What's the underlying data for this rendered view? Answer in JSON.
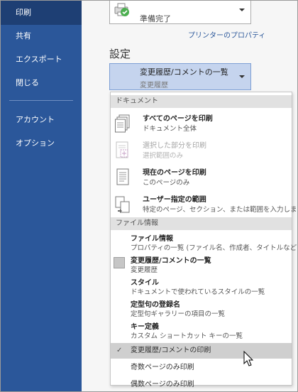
{
  "sidebar": {
    "items": [
      {
        "label": "印刷",
        "active": true
      },
      {
        "label": "共有"
      },
      {
        "label": "エクスポート"
      },
      {
        "label": "閉じる"
      },
      {
        "label": "アカウント"
      },
      {
        "label": "オプション"
      }
    ]
  },
  "printer": {
    "status": "準備完了",
    "properties_link": "プリンターのプロパティ"
  },
  "settings": {
    "heading": "設定",
    "selected_main": "変更履歴/コメントの一覧",
    "selected_sub": "変更履歴"
  },
  "dropdown": {
    "document_header": "ドキュメント",
    "document_options": [
      {
        "title": "すべてのページを印刷",
        "sub": "ドキュメント全体",
        "enabled": true
      },
      {
        "title": "選択した部分を印刷",
        "sub": "選択範囲のみ",
        "enabled": false
      },
      {
        "title": "現在のページを印刷",
        "sub": "このページのみ",
        "enabled": true
      },
      {
        "title": "ユーザー指定の範囲",
        "sub": "特定のページ、セクション、または範囲を入力します",
        "enabled": true
      }
    ],
    "info_header": "ファイル情報",
    "info_options": [
      {
        "title": "ファイル情報",
        "sub": "プロパティの一覧 (ファイル名、作成者、タイトルなど)"
      },
      {
        "title": "変更履歴/コメントの一覧",
        "sub": "変更履歴",
        "selected": true
      },
      {
        "title": "スタイル",
        "sub": "ドキュメントで使われているスタイルの一覧"
      },
      {
        "title": "定型句の登録名",
        "sub": "定型句ギャラリーの項目の一覧"
      },
      {
        "title": "キー定義",
        "sub": "カスタム ショートカット キーの一覧"
      }
    ],
    "extra_options": [
      {
        "label": "変更履歴/コメントの印刷",
        "checked": true,
        "hover": true
      },
      {
        "label": "奇数ページのみ印刷"
      },
      {
        "label": "偶数ページのみ印刷"
      }
    ],
    "checkmark": "✓"
  },
  "colors": {
    "sidebar": "#2b579a",
    "sidebar_active": "#1e3f74",
    "select_box": "#c5d4ee",
    "link": "#2b579a"
  }
}
